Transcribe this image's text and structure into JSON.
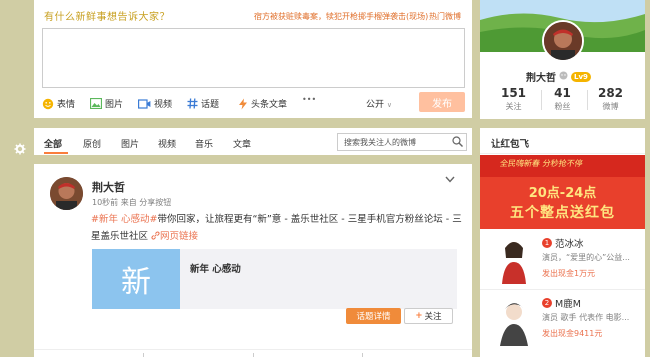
{
  "compose": {
    "prompt": "有什么新鲜事想告诉大家？",
    "hot_link": "宿方被获赃赎毒案，犊犯开枪掷手榴弹袭击(现场)",
    "hot_weibo": "热门微博",
    "tools": [
      {
        "icon": "emoji-icon",
        "label": "表情"
      },
      {
        "icon": "image-icon",
        "label": "图片"
      },
      {
        "icon": "video-icon",
        "label": "视频"
      },
      {
        "icon": "hashtag-icon",
        "label": "话题"
      },
      {
        "icon": "headline-icon",
        "label": "头条文章"
      },
      {
        "icon": "more-icon",
        "label": "•••"
      }
    ],
    "visibility": "公开",
    "publish": "发布"
  },
  "tabs": {
    "items": [
      "全部",
      "原创",
      "图片",
      "视频",
      "音乐",
      "文章"
    ],
    "search_placeholder": "搜索我关注人的微博"
  },
  "post": {
    "author": "荆大哲",
    "meta": "10秒前 来自 分享按钮",
    "topic1": "#新年 心感动#",
    "text1": "带你回家，让旅程更有“新”意 - 盖乐世社区 - 三星手机官方粉丝论坛 - 三星盖乐世社区",
    "link_icon": "link-icon",
    "link_label": "网页链接",
    "share_thumb_char": "新",
    "share_title": "新年 心感动",
    "topic_button": "话题详情",
    "follow_button": "关注"
  },
  "profile": {
    "name": "荆大哲",
    "level": "Lv9",
    "stats": [
      {
        "num": "151",
        "label": "关注"
      },
      {
        "num": "41",
        "label": "粉丝"
      },
      {
        "num": "282",
        "label": "微博"
      }
    ]
  },
  "red_packet": {
    "title": "让红包飞",
    "banner_top": "全民嗨新春 分秒抢不停",
    "banner_line1": "20点-24点",
    "banner_line2": "五个整点送红包",
    "people": [
      {
        "rank": "1",
        "name": "范冰冰",
        "desc": "演员，“爱里的心”公益...",
        "cash": "发出现金1万元"
      },
      {
        "rank": "2",
        "name": "M鹿M",
        "desc": "演员 歌手 代表作 电影...",
        "cash": "发出现金9411元"
      }
    ]
  },
  "colors": {
    "page_bg": "#d0cda4",
    "accent": "#fa7d3c",
    "publish_disabled": "#ffc09f",
    "topic": "#eb7350"
  }
}
